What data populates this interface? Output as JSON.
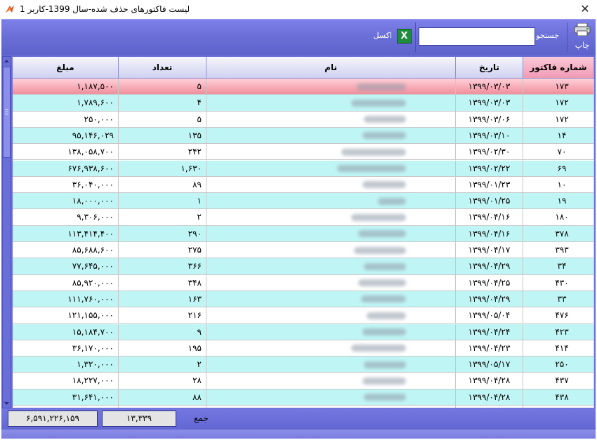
{
  "window": {
    "title": "لیست فاکتورهای حذف شده-سال 1399-کاربر 1",
    "close_glyph": "✕"
  },
  "toolbar": {
    "print_label": "چاپ",
    "search_label": "جستجو",
    "search_value": "",
    "excel_label": "اکسل",
    "excel_glyph": "X"
  },
  "grid": {
    "columns": {
      "invoice_no": "شماره فاکتور",
      "date": "تاریخ",
      "name": "نام",
      "quantity": "تعداد",
      "amount": "مبلغ"
    },
    "sorted_column": "invoice_no",
    "selected_row": 0,
    "rows": [
      {
        "invoice_no": "۱۷۳",
        "date": "۱۳۹۹/۰۳/۰۳",
        "quantity": "۵",
        "amount": "۱,۱۸۷,۵۰۰"
      },
      {
        "invoice_no": "۱۷۲",
        "date": "۱۳۹۹/۰۳/۰۳",
        "quantity": "۴",
        "amount": "۱,۷۸۹,۶۰۰"
      },
      {
        "invoice_no": "۱۷۲",
        "date": "۱۳۹۹/۰۳/۰۶",
        "quantity": "۵",
        "amount": "۲۵۰,۰۰۰"
      },
      {
        "invoice_no": "۱۴",
        "date": "۱۳۹۹/۰۳/۱۰",
        "quantity": "۱۳۵",
        "amount": "۹۵,۱۴۶,۰۲۹"
      },
      {
        "invoice_no": "۷۰",
        "date": "۱۳۹۹/۰۲/۳۰",
        "quantity": "۲۴۲",
        "amount": "۱۳۸,۰۵۸,۷۰۰"
      },
      {
        "invoice_no": "۶۹",
        "date": "۱۳۹۹/۰۲/۲۲",
        "quantity": "۱,۶۳۰",
        "amount": "۶۷۶,۹۳۸,۶۰۰"
      },
      {
        "invoice_no": "۱۰",
        "date": "۱۳۹۹/۰۱/۲۳",
        "quantity": "۸۹",
        "amount": "۳۶,۰۴۰,۰۰۰"
      },
      {
        "invoice_no": "۱۹",
        "date": "۱۳۹۹/۰۱/۲۵",
        "quantity": "۱",
        "amount": "۱۸,۰۰۰,۰۰۰"
      },
      {
        "invoice_no": "۱۸۰",
        "date": "۱۳۹۹/۰۴/۱۶",
        "quantity": "۲",
        "amount": "۹,۳۰۶,۰۰۰"
      },
      {
        "invoice_no": "۳۷۸",
        "date": "۱۳۹۹/۰۴/۱۶",
        "quantity": "۲۹۰",
        "amount": "۱۱۳,۴۱۴,۴۰۰"
      },
      {
        "invoice_no": "۳۹۳",
        "date": "۱۳۹۹/۰۴/۱۷",
        "quantity": "۲۷۵",
        "amount": "۸۵,۶۸۸,۶۰۰"
      },
      {
        "invoice_no": "۳۴",
        "date": "۱۳۹۹/۰۴/۲۹",
        "quantity": "۳۶۶",
        "amount": "۷۷,۶۴۵,۰۰۰"
      },
      {
        "invoice_no": "۴۳۰",
        "date": "۱۳۹۹/۰۴/۲۵",
        "quantity": "۳۴۸",
        "amount": "۸۵,۹۲۰,۰۰۰"
      },
      {
        "invoice_no": "۳۳",
        "date": "۱۳۹۹/۰۴/۲۹",
        "quantity": "۱۶۳",
        "amount": "۱۱۱,۷۶۰,۰۰۰"
      },
      {
        "invoice_no": "۴۷۶",
        "date": "۱۳۹۹/۰۵/۰۴",
        "quantity": "۲۱۶",
        "amount": "۱۲۱,۱۵۵,۰۰۰"
      },
      {
        "invoice_no": "۴۲۳",
        "date": "۱۳۹۹/۰۴/۲۴",
        "quantity": "۹",
        "amount": "۱۵,۱۸۴,۷۰۰"
      },
      {
        "invoice_no": "۴۱۴",
        "date": "۱۳۹۹/۰۴/۲۳",
        "quantity": "۱۹۵",
        "amount": "۳۶,۱۷۰,۰۰۰"
      },
      {
        "invoice_no": "۲۵۰",
        "date": "۱۳۹۹/۰۵/۱۷",
        "quantity": "۲",
        "amount": "۱,۳۲۰,۰۰۰"
      },
      {
        "invoice_no": "۴۳۷",
        "date": "۱۳۹۹/۰۴/۲۸",
        "quantity": "۲۸",
        "amount": "۱۸,۲۲۷,۰۰۰"
      },
      {
        "invoice_no": "۴۳۸",
        "date": "۱۳۹۹/۰۴/۲۸",
        "quantity": "۸۸",
        "amount": "۳۱,۶۴۱,۰۰۰"
      },
      {
        "invoice_no": "",
        "date": "",
        "quantity": "",
        "amount": ""
      }
    ]
  },
  "footer": {
    "sum_label": "جمع",
    "total_quantity": "۱۳,۳۳۹",
    "total_amount": "۶,۵۹۱,۲۲۶,۱۵۹"
  },
  "colors": {
    "accent": "#6b6fd8",
    "row_alt": "#c0f5f5",
    "row_selected": "#ef8e9c",
    "sorted_header": "#f09bb4"
  }
}
